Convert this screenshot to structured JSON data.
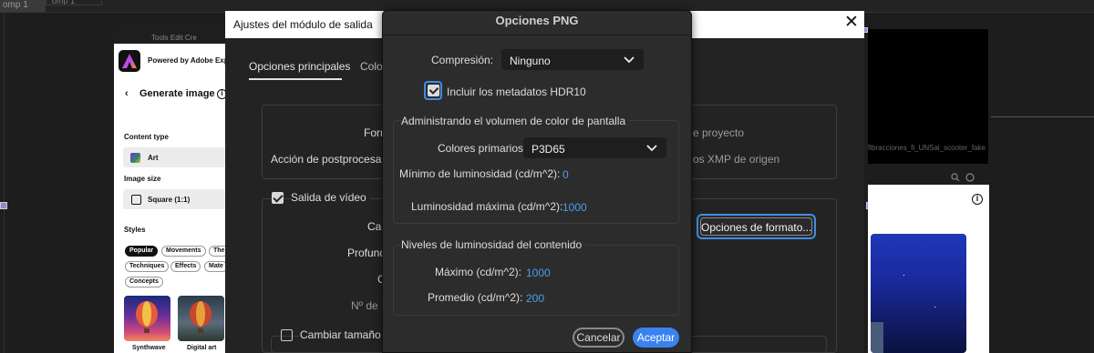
{
  "background": {
    "tabs": [
      "omp 1",
      "omp 1"
    ],
    "express": {
      "powered_by": "Powered by Adobe Exp",
      "toolbar_text": "Tools   Edit   Cre",
      "back_arrow": "‹",
      "generate_title": "Generate image",
      "content_type_label": "Content type",
      "content_type_value": "Art",
      "image_size_label": "Image size",
      "image_size_value": "Square (1:1)",
      "styles_label": "Styles",
      "chips": [
        "Popular",
        "Movements",
        "The",
        "Techniques",
        "Effects",
        "Mate",
        "Concepts"
      ],
      "thumbnails": [
        "Synthwave",
        "Digital art"
      ]
    },
    "right_panel_filename": "fibracciones_fi_UNSal_scooter_fake"
  },
  "main_dialog": {
    "title": "Ajustes del módulo de salida",
    "close_glyph": "✕",
    "tabs": [
      "Opciones principales",
      "Colo"
    ],
    "format_label": "Form",
    "post_render_label": "Acción de postprocesami",
    "right_text_1": "e proyecto",
    "right_text_2": "os XMP de origen",
    "video_output_label": "Salida de vídeo",
    "channels_label": "Car",
    "depth_label": "Profund",
    "color_label": "C",
    "start_number_label": "Nº de i",
    "format_options_button": "Opciones de formato...",
    "resize_label": "Cambiar tamaño"
  },
  "png_dialog": {
    "title": "Opciones PNG",
    "compression_label": "Compresión:",
    "compression_value": "Ninguno",
    "hdr10_label": "Incluir los metadatos HDR10",
    "hdr10_checked": true,
    "mastering_group_title": "Administrando el volumen de color de pantalla",
    "primaries_label": "Colores primarios:",
    "primaries_value": "P3D65",
    "min_lum_label": "Mínimo de luminosidad (cd/m^2):",
    "min_lum_value": "0",
    "max_lum_label": "Luminosidad máxima (cd/m^2):",
    "max_lum_value": "1000",
    "content_group_title": "Niveles de luminosidad del contenido",
    "max_label": "Máximo (cd/m^2):",
    "max_value": "1000",
    "avg_label": "Promedio (cd/m^2):",
    "avg_value": "200",
    "cancel_button": "Cancelar",
    "ok_button": "Aceptar"
  },
  "colors": {
    "accent": "#3b82f0",
    "value_blue": "#4a9ef0",
    "dialog_bg": "#2c2c2c"
  }
}
